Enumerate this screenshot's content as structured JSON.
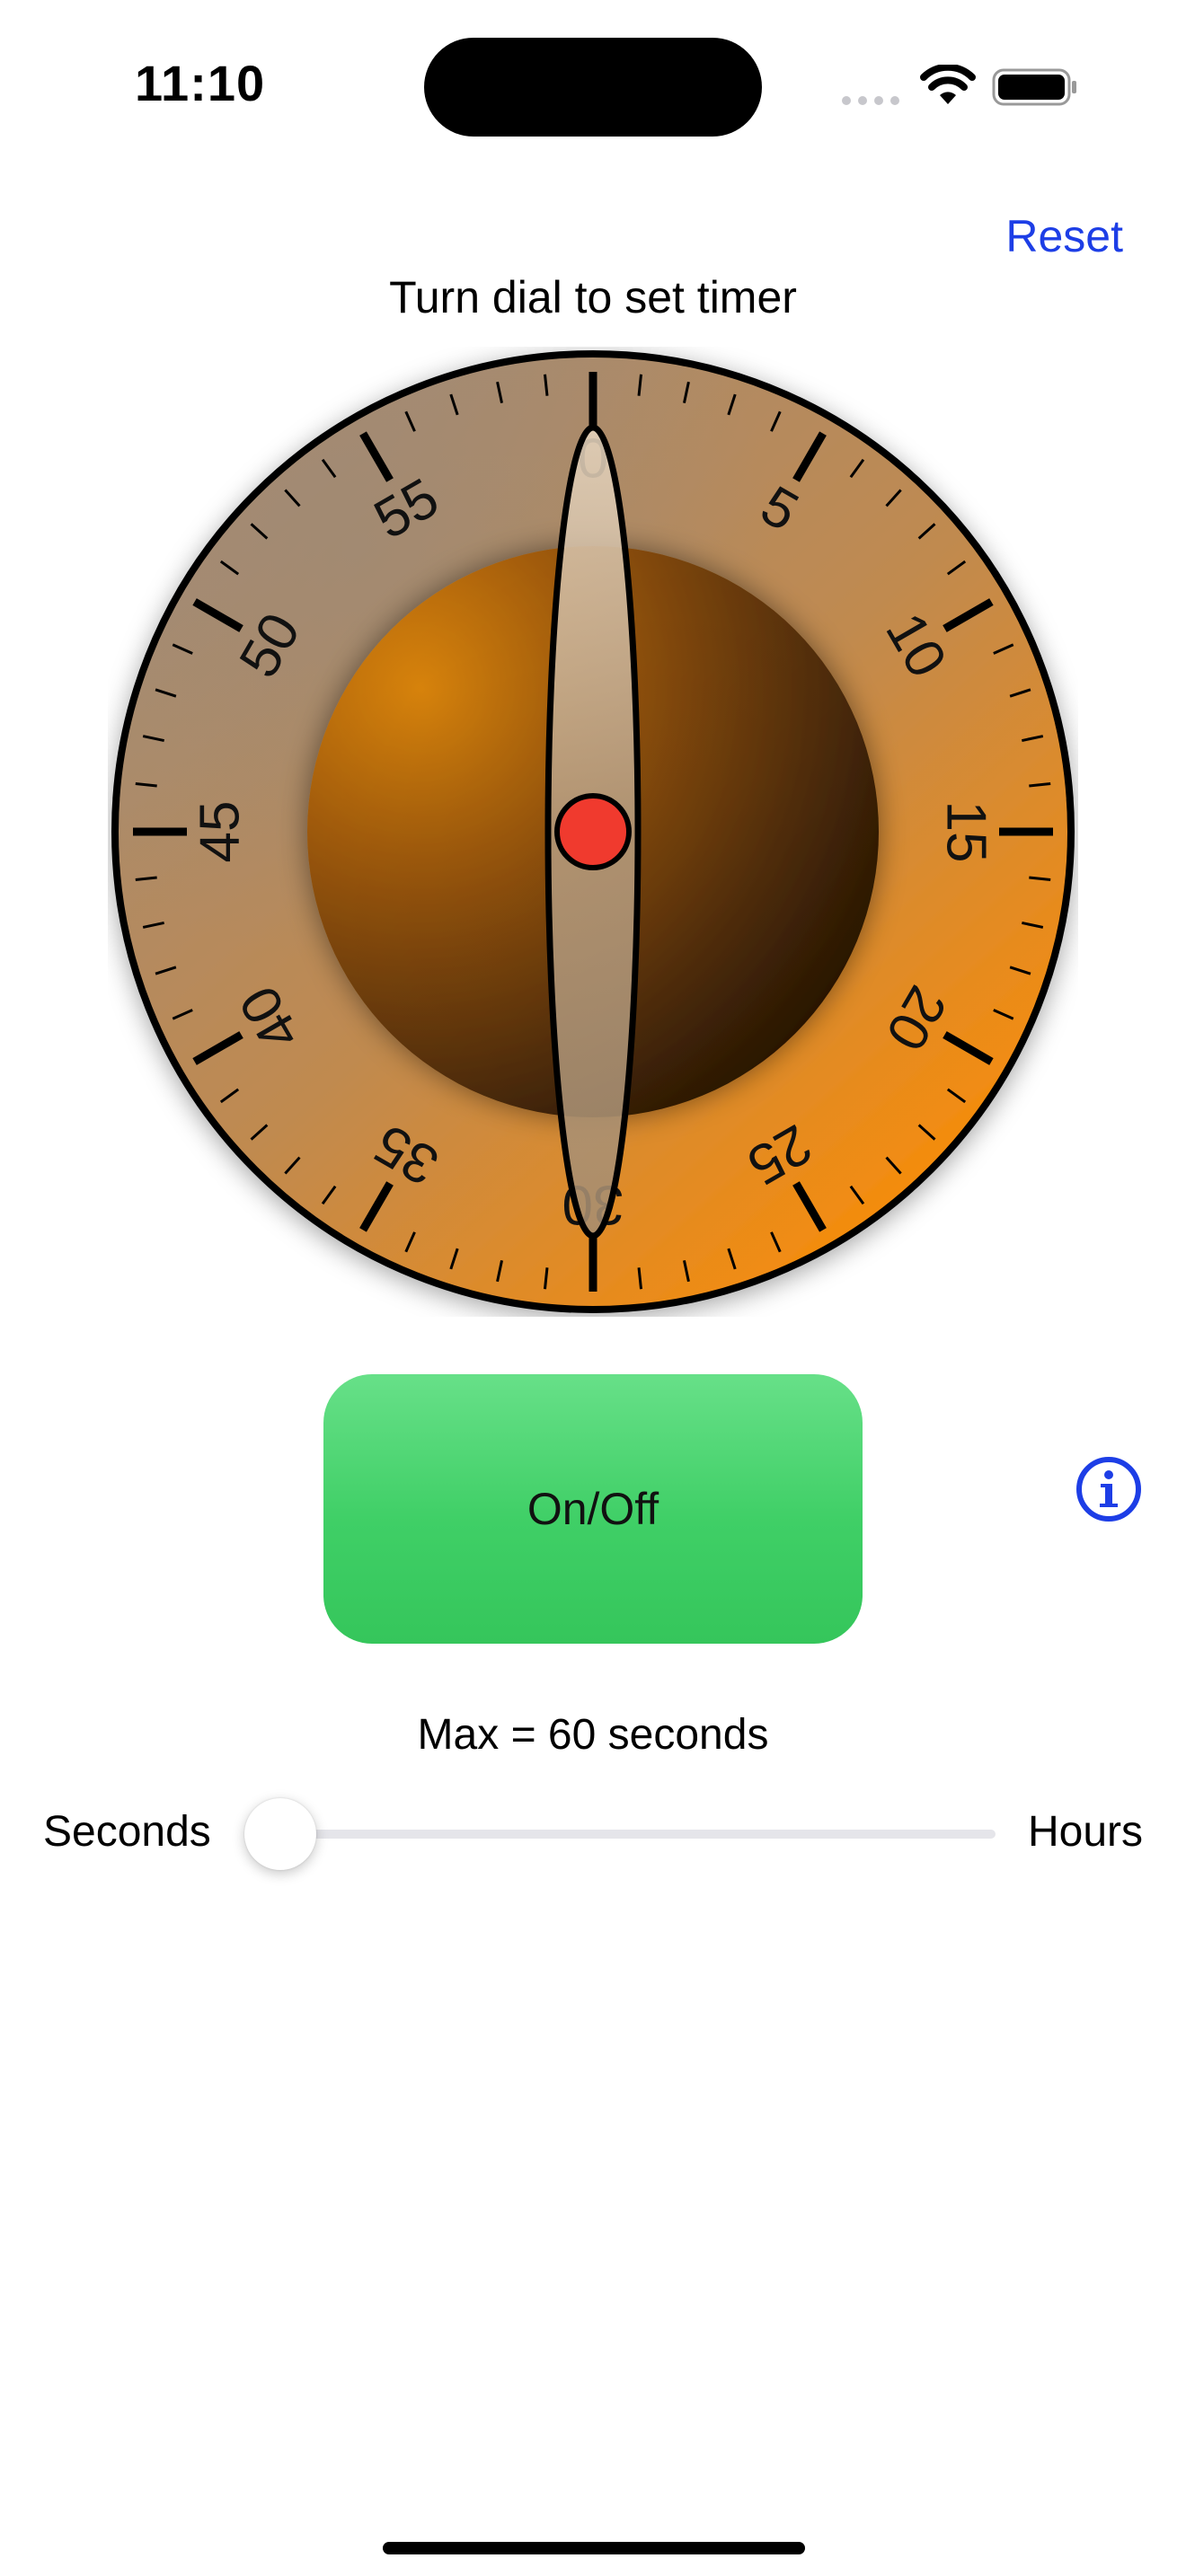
{
  "status_bar": {
    "time": "11:10"
  },
  "header": {
    "reset_label": "Reset",
    "instruction": "Turn dial to set timer"
  },
  "dial": {
    "labels": [
      "0",
      "5",
      "10",
      "15",
      "20",
      "25",
      "30",
      "35",
      "40",
      "45",
      "50",
      "55"
    ],
    "pointer_value": 0,
    "colors": {
      "ring_light": "#a88b6f",
      "ring_orange": "#ff8c00",
      "knob_orange": "#d97f10",
      "knob_dark": "#3a2006",
      "center_dot": "#f03a2e"
    }
  },
  "controls": {
    "onoff_label": "On/Off",
    "info_icon": "info-circle-icon",
    "max_label": "Max = 60 seconds",
    "slider": {
      "min_label": "Seconds",
      "max_label": "Hours",
      "value": 0
    }
  },
  "colors": {
    "accent": "#1d3ee6",
    "button_green": "#3fcf66"
  }
}
